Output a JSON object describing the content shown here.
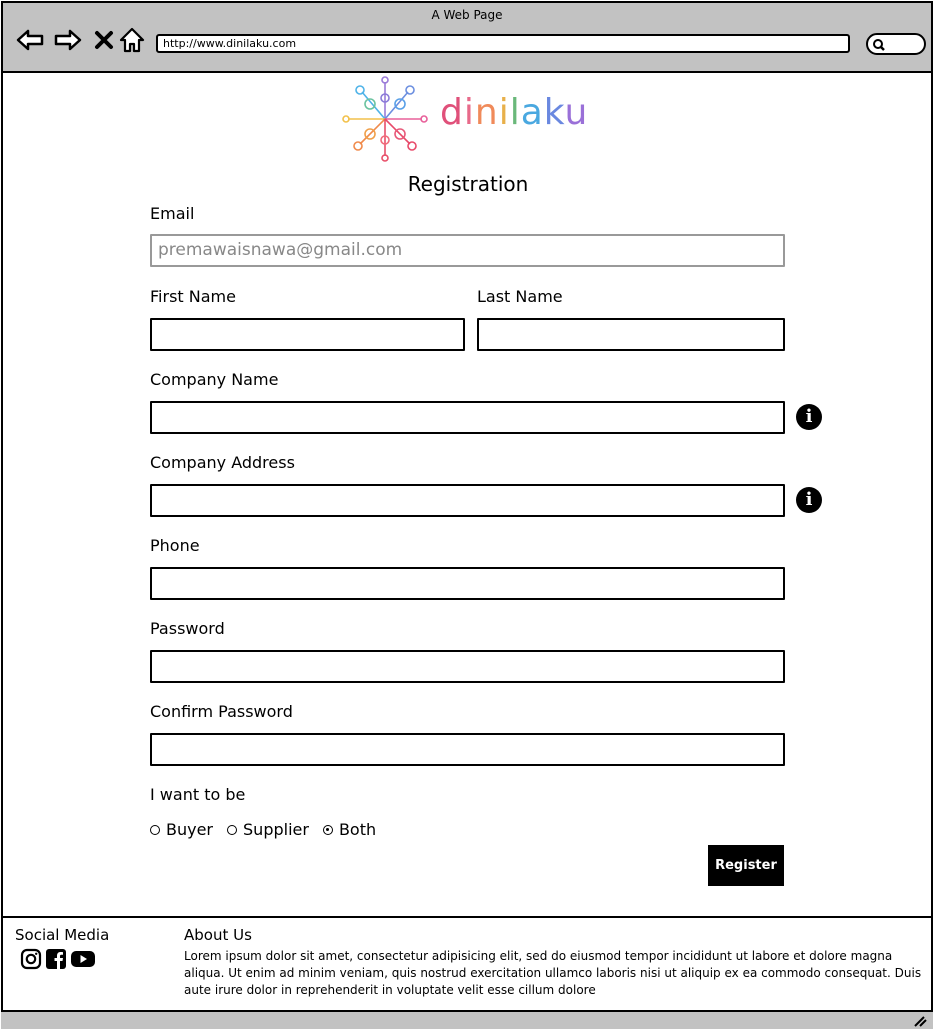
{
  "window": {
    "title": "A Web Page",
    "url": "http://www.dinilaku.com"
  },
  "brand": {
    "name": "dinilaku"
  },
  "form": {
    "title": "Registration",
    "email_label": "Email",
    "email_value": "premawaisnawa@gmail.com",
    "first_name_label": "First Name",
    "last_name_label": "Last Name",
    "company_name_label": "Company Name",
    "company_address_label": "Company Address",
    "phone_label": "Phone",
    "password_label": "Password",
    "confirm_password_label": "Confirm Password",
    "role_label": "I want to be",
    "role_options": [
      "Buyer",
      "Supplier",
      "Both"
    ],
    "selected_role": "Both",
    "register_label": "Register"
  },
  "footer": {
    "social_title": "Social Media",
    "about_title": "About Us",
    "about_text": "Lorem ipsum dolor sit amet, consectetur adipisicing elit, sed do eiusmod tempor incididunt ut labore et dolore magna aliqua. Ut enim ad minim veniam, quis nostrud exercitation ullamco laboris nisi ut aliquip ex ea commodo consequat. Duis aute irure dolor in reprehenderit in voluptate velit esse cillum dolore",
    "social_icons": [
      "instagram-icon",
      "facebook-icon",
      "youtube-icon"
    ]
  }
}
